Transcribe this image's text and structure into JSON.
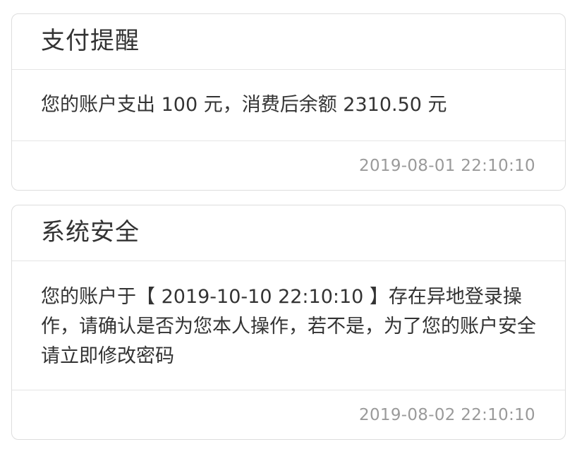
{
  "messages": [
    {
      "title": "支付提醒",
      "content": "您的账户支出 100 元，消费后余额 2310.50 元",
      "time": "2019-08-01 22:10:10"
    },
    {
      "title": "系统安全",
      "content": "您的账户于【 2019-10-10 22:10:10 】存在异地登录操作，请确认是否为您本人操作，若不是，为了您的账户安全请立即修改密码",
      "time": "2019-08-02 22:10:10"
    }
  ]
}
